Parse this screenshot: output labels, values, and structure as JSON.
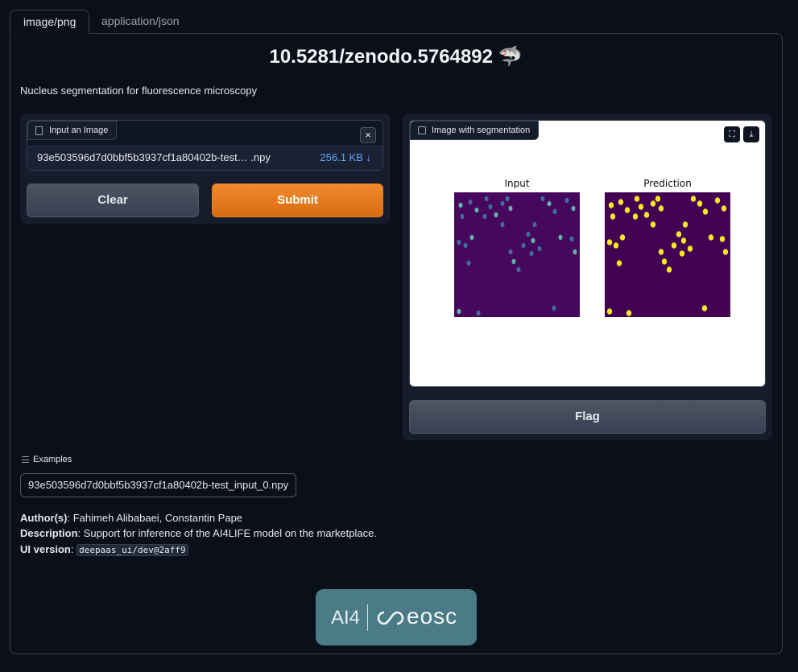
{
  "tabs": [
    {
      "label": "image/png",
      "active": true
    },
    {
      "label": "application/json",
      "active": false
    }
  ],
  "title": "10.5281/zenodo.5764892 🦈",
  "subtitle": "Nucleus segmentation for fluorescence microscopy",
  "input_panel": {
    "label": "Input an Image",
    "file_name": "93e503596d7d0bbf5b3937cf1a80402b-test… .npy",
    "file_size": "256.1 KB ↓",
    "close_glyph": "×",
    "clear_label": "Clear",
    "submit_label": "Submit"
  },
  "output_panel": {
    "label": "Image with segmentation",
    "fullscreen_glyph": "⛶",
    "download_glyph": "⤓",
    "plot_titles": [
      "Input",
      "Prediction"
    ],
    "flag_label": "Flag"
  },
  "examples": {
    "label": "Examples",
    "items": [
      "93e503596d7d0bbf5b3937cf1a80402b-test_input_0.npy"
    ]
  },
  "meta": {
    "authors_label": "Author(s)",
    "authors": ": Fahimeh Alibabaei, Constantin Pape",
    "description_label": "Description",
    "description": ": Support for inference of the AI4LIFE model on the marketplace.",
    "ui_version_label": "UI version",
    "ui_version_sep": ":",
    "ui_version": "deepaas_ui/dev@2aff9"
  },
  "logo": {
    "left": "AI4",
    "right": "eosc"
  },
  "colors": {
    "background": "#0b0f19",
    "accent": "#e8761c",
    "link": "#60a5fa",
    "logo_bg": "#4b7b86",
    "viridis_dark": "#440154",
    "viridis_yellow": "#fde725"
  }
}
